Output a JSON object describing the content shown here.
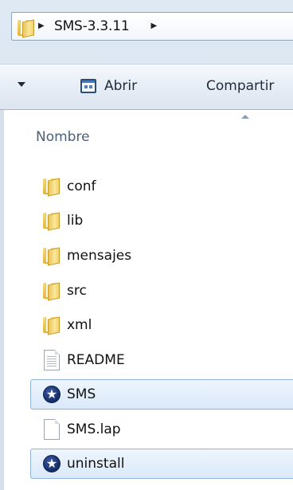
{
  "address_bar": {
    "breadcrumb": [
      "SMS-3.3.11"
    ],
    "folder_icon": "folder-icon"
  },
  "toolbar": {
    "organize_icon": "dropdown-arrow-icon",
    "open_label": "Abrir",
    "open_icon": "open-window-icon",
    "share_label": "Compartir"
  },
  "column_header": {
    "name_label": "Nombre"
  },
  "files": [
    {
      "name": "conf",
      "type": "folder",
      "icon": "folder-icon",
      "selected": false
    },
    {
      "name": "lib",
      "type": "folder",
      "icon": "folder-icon",
      "selected": false
    },
    {
      "name": "mensajes",
      "type": "folder",
      "icon": "folder-icon",
      "selected": false
    },
    {
      "name": "src",
      "type": "folder",
      "icon": "folder-icon",
      "selected": false
    },
    {
      "name": "xml",
      "type": "folder",
      "icon": "folder-icon",
      "selected": false
    },
    {
      "name": "README",
      "type": "text",
      "icon": "text-document-icon",
      "selected": false
    },
    {
      "name": "SMS",
      "type": "app",
      "icon": "star-app-icon",
      "selected": true
    },
    {
      "name": "SMS.lap",
      "type": "file",
      "icon": "blank-document-icon",
      "selected": false
    },
    {
      "name": "uninstall",
      "type": "app",
      "icon": "star-app-icon",
      "selected": true
    }
  ],
  "colors": {
    "selection_border": "#8fb3dc",
    "selection_fill": "#dae9fa",
    "header_text": "#4c607a"
  }
}
